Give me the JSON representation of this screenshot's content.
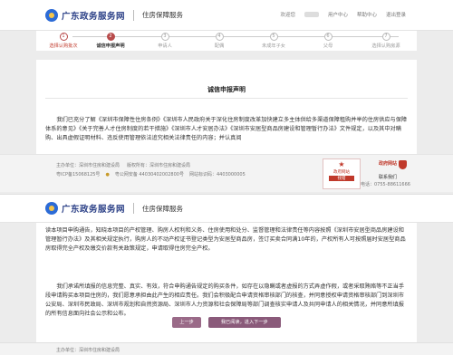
{
  "header": {
    "site_name": "广东政务服务网",
    "service_name": "住房保障服务",
    "greeting": "欢迎您",
    "nav": [
      "用户中心",
      "帮助中心",
      "退出登录"
    ]
  },
  "steps": [
    {
      "num": "1",
      "label": "选择认购批次",
      "state": "done"
    },
    {
      "num": "2",
      "label": "诚信申报声明",
      "state": "current"
    },
    {
      "num": "3",
      "label": "申请人",
      "state": "todo"
    },
    {
      "num": "4",
      "label": "配偶",
      "state": "todo"
    },
    {
      "num": "5",
      "label": "未成年子女",
      "state": "todo"
    },
    {
      "num": "6",
      "label": "父母",
      "state": "todo"
    },
    {
      "num": "7",
      "label": "选择认购房源",
      "state": "todo"
    }
  ],
  "declaration": {
    "title": "诚信申报声明",
    "para1": "我们已充分了解《深圳市保障性住房条例》《深圳市人民政府关于深化住房制度改革加快建立多主体供给多渠道保障租购并举的住房供应与保障体系的意见》《关于完善人才住房制度的若干措施》《深圳市人才安居办法》《深圳市安居型商品房建设和管理暂行办法》文件规定，以及其中对瞒购、出具虚假证明材料、违反使用管理依法追究相关法律责任的内容；并认真阅",
    "para2": "读本项目申购通告，知晓本项目的产权管理、购房人权利和义务、住房使用和处分、监督管理和法律责任等内容按照《深圳市安居型商品房建设和管理暂行办法》及其相关规定执行，购房人的不动产权证书登记类型为安居型商品房，签订买卖合同满10年的，产权所有人可按照届时安居型商品房取得完全产权及缴交价款有关政策规定，申请取得住房完全产权。",
    "para3": "我们承诺所填报的信息完整、真实、有效，符合申购通告规定的购买条件，如存在以隐瞒或者虚报的方式弄虚作假，或者采取贿赂等不正当手段申请购买本项目住房的，我们愿意承担由此产生的相应责任。我们会积极配合申请资格审核部门的核查，并同意授权申请资格审核部门到深圳市公安局、深圳市民政局、深圳市规划和自然资源局、深圳市人力资源和社会保障局等部门调查核实申请人及共同申请人的相关情况，并同意所填报的所有信息面向社会公示和公布。"
  },
  "buttons": {
    "prev": "上一步",
    "next": "我已阅读，进入下一步"
  },
  "footer": {
    "links": [
      "主办单位：深圳市住房和建设局",
      "版权所有：深圳市住房和建设局"
    ],
    "icp": "粤ICP备15068125号",
    "police": "粤公网安备 44030402002800号",
    "site_code": "网站标识码：4403000005",
    "badge_top": "政府网站",
    "badge_bottom": "找错",
    "gov_label": "政府网站",
    "contact": "联系我们",
    "phone": "电话：0755-88611666"
  },
  "colors": {
    "brand": "#2a3f86",
    "accent": "#b84b4b",
    "button": "#8a5a7a"
  }
}
